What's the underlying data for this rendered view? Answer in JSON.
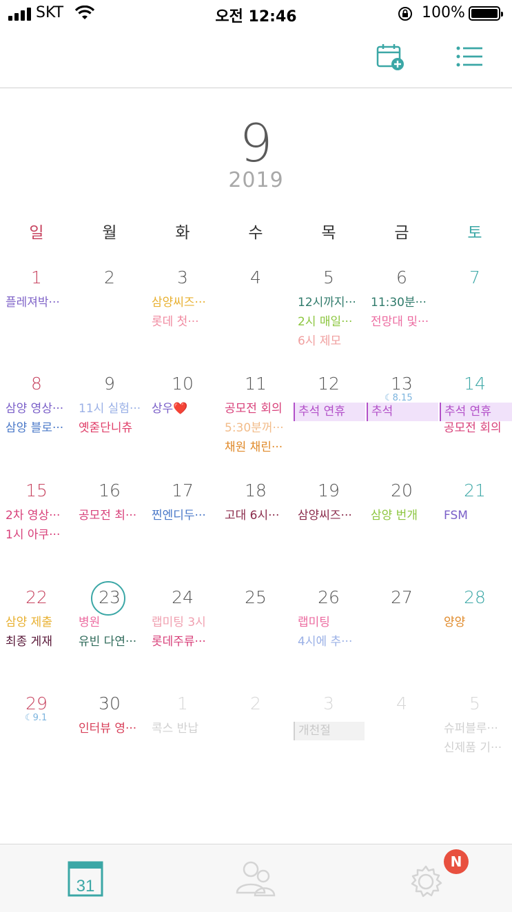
{
  "status_bar": {
    "carrier": "SKT",
    "time": "오전 12:46",
    "battery": "100%"
  },
  "header": {
    "month": "9",
    "year": "2019"
  },
  "weekdays": [
    "일",
    "월",
    "화",
    "수",
    "목",
    "금",
    "토"
  ],
  "weeks": [
    [
      {
        "date": "1",
        "events": [
          {
            "text": "플레져박···",
            "color": "#8064c8"
          }
        ]
      },
      {
        "date": "2",
        "events": []
      },
      {
        "date": "3",
        "events": [
          {
            "text": "삼양씨즈···",
            "color": "#e8b030"
          },
          {
            "text": "롯데 첫···",
            "color": "#f08aa0"
          }
        ]
      },
      {
        "date": "4",
        "events": []
      },
      {
        "date": "5",
        "events": [
          {
            "text": "12시까지···",
            "color": "#2f7a6a"
          },
          {
            "text": "2시 매일···",
            "color": "#8cc63f"
          },
          {
            "text": "6시 제모",
            "color": "#f0a0a0"
          }
        ]
      },
      {
        "date": "6",
        "events": [
          {
            "text": "11:30분···",
            "color": "#2f7a6a"
          },
          {
            "text": "전망대 및···",
            "color": "#ec6ba0"
          }
        ]
      },
      {
        "date": "7",
        "events": []
      }
    ],
    [
      {
        "date": "8",
        "events": [
          {
            "text": "삼양 영상···",
            "color": "#7a5fc8"
          },
          {
            "text": "삼양 블로···",
            "color": "#4a78c8"
          }
        ]
      },
      {
        "date": "9",
        "events": [
          {
            "text": "11시 실험···",
            "color": "#9ab0e6"
          },
          {
            "text": "옛줃단니츄",
            "color": "#e0406a"
          }
        ]
      },
      {
        "date": "10",
        "events": [
          {
            "text": "상우❤️",
            "color": "#7a5fc8"
          }
        ]
      },
      {
        "date": "11",
        "events": [
          {
            "text": "공모전 회의",
            "color": "#d8407a"
          },
          {
            "text": "5:30분꺼···",
            "color": "#f2bc8a"
          },
          {
            "text": "채원 채린···",
            "color": "#e08a2a"
          }
        ]
      },
      {
        "date": "12",
        "events": []
      },
      {
        "date": "13",
        "lunar": "8.15",
        "events": []
      },
      {
        "date": "14",
        "events": [
          {
            "text": "",
            "color": "#ffffff"
          },
          {
            "text": "공모전 회의",
            "color": "#d8407a"
          }
        ]
      }
    ],
    [
      {
        "date": "15",
        "events": [
          {
            "text": "2차 영상···",
            "color": "#d8407a"
          },
          {
            "text": "1시 아쿠···",
            "color": "#d8407a"
          }
        ]
      },
      {
        "date": "16",
        "events": [
          {
            "text": "공모전 최···",
            "color": "#d8407a"
          }
        ]
      },
      {
        "date": "17",
        "events": [
          {
            "text": "찐엔디두···",
            "color": "#4a78c8"
          }
        ]
      },
      {
        "date": "18",
        "events": [
          {
            "text": "고대 6시···",
            "color": "#8a2a4a"
          }
        ]
      },
      {
        "date": "19",
        "events": [
          {
            "text": "삼양씨즈···",
            "color": "#8a2a4a"
          }
        ]
      },
      {
        "date": "20",
        "events": [
          {
            "text": "삼양 번개",
            "color": "#8cc63f"
          }
        ]
      },
      {
        "date": "21",
        "events": [
          {
            "text": "FSM",
            "color": "#7a5fc8"
          }
        ]
      }
    ],
    [
      {
        "date": "22",
        "events": [
          {
            "text": "삼양 제출",
            "color": "#e8b030"
          },
          {
            "text": "최종 게재",
            "color": "#5a1a3a"
          }
        ]
      },
      {
        "date": "23",
        "today": true,
        "events": [
          {
            "text": "병원",
            "color": "#ec6ba0"
          },
          {
            "text": "유빈 다연···",
            "color": "#2f6a5a"
          }
        ]
      },
      {
        "date": "24",
        "events": [
          {
            "text": "랩미팅 3시",
            "color": "#f0a0b0"
          },
          {
            "text": "롯데주류···",
            "color": "#d8407a"
          }
        ]
      },
      {
        "date": "25",
        "events": []
      },
      {
        "date": "26",
        "events": [
          {
            "text": "랩미팅",
            "color": "#ec6ba0"
          },
          {
            "text": "4시에 추···",
            "color": "#9ab0e6"
          }
        ]
      },
      {
        "date": "27",
        "events": []
      },
      {
        "date": "28",
        "events": [
          {
            "text": "양양",
            "color": "#e08a2a"
          }
        ]
      }
    ],
    [
      {
        "date": "29",
        "lunar": "9.1",
        "events": []
      },
      {
        "date": "30",
        "events": [
          {
            "text": "인터뷰 영···",
            "color": "#d8405a"
          }
        ]
      },
      {
        "date": "1",
        "dim": true,
        "events": [
          {
            "text": "콕스 반납",
            "color": "#d0d0d0"
          }
        ]
      },
      {
        "date": "2",
        "dim": true,
        "events": []
      },
      {
        "date": "3",
        "dim": true,
        "events": []
      },
      {
        "date": "4",
        "dim": true,
        "events": []
      },
      {
        "date": "5",
        "dim": true,
        "events": [
          {
            "text": "슈퍼블루···",
            "color": "#d0d0d0"
          },
          {
            "text": "신제품 기···",
            "color": "#d0d0d0"
          }
        ]
      }
    ]
  ],
  "bars": {
    "chuseok_a": "추석 연휴",
    "chuseok_b": "추석",
    "chuseok_c": "추석 연휴",
    "gaecheonjeol": "개천절"
  },
  "tabbar": {
    "calendar_day": "31",
    "badge": "N"
  },
  "colors": {
    "accent": "#3ba7a6",
    "sunday": "#c7435f",
    "saturday": "#3ba7a6",
    "holiday_bar": "#f1e2fa",
    "holiday_text": "#b24fc8",
    "badge": "#e8503f"
  }
}
